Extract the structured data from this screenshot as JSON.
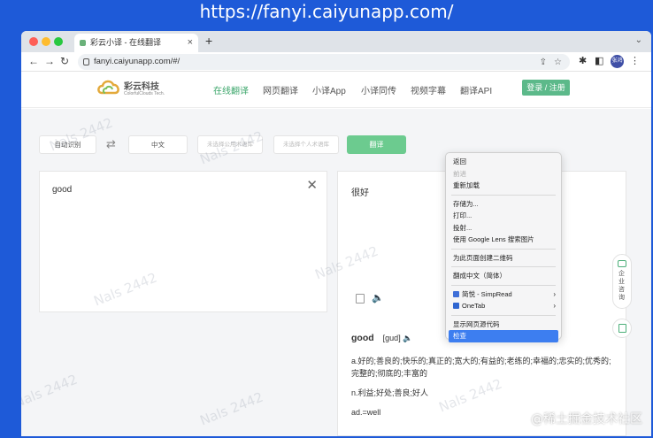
{
  "banner": {
    "url": "https://fanyi.caiyunapp.com/"
  },
  "browser": {
    "tab_title": "彩云小译 - 在线翻译",
    "address": "fanyi.caiyunapp.com/#/",
    "profile_label": "张鸿"
  },
  "site": {
    "logo_text": "彩云科技",
    "logo_sub": "ColorfulClouds Tech.",
    "nav": [
      {
        "label": "在线翻译",
        "active": true
      },
      {
        "label": "网页翻译"
      },
      {
        "label": "小译App"
      },
      {
        "label": "小译同传"
      },
      {
        "label": "视频字幕"
      },
      {
        "label": "翻译API"
      }
    ],
    "login_label": "登录 / 注册"
  },
  "translator": {
    "source_lang": "自动识别",
    "target_lang": "中文",
    "term_placeholder": "未选择公用术语库",
    "personal_placeholder": "未选择个人术语库",
    "translate_label": "翻译",
    "source_text": "good",
    "target_text": "很好"
  },
  "dictionary": {
    "word": "good",
    "phonetic": "[gud]",
    "entries": [
      "a.好的;善良的;快乐的;真正的;宽大的;有益的;老练的;幸福的;忠实的;优秀的;完整的;彻底的;丰富的",
      "n.利益;好处;善良;好人",
      "ad.=well"
    ]
  },
  "side_widget": {
    "label": "企业咨询"
  },
  "context_menu": {
    "groups": [
      [
        {
          "label": "返回"
        },
        {
          "label": "前进",
          "disabled": true
        },
        {
          "label": "重新加载"
        }
      ],
      [
        {
          "label": "存储为..."
        },
        {
          "label": "打印..."
        },
        {
          "label": "投射..."
        },
        {
          "label": "使用 Google Lens 搜索图片"
        }
      ],
      [
        {
          "label": "为此页面创建二维码"
        }
      ],
      [
        {
          "label": "翻成中文（简体）"
        }
      ],
      [
        {
          "label": "简悦 - SimpRead",
          "submenu": true,
          "icon_color": "#3f6fd8"
        },
        {
          "label": "OneTab",
          "submenu": true,
          "icon_color": "#2f66d0"
        }
      ],
      [
        {
          "label": "显示网页源代码"
        },
        {
          "label": "检查",
          "selected": true
        }
      ]
    ]
  },
  "watermarks": {
    "text": "Nals 2442",
    "bottom": "@稀土掘金技术社区"
  },
  "colors": {
    "accent_green": "#5cb98a",
    "banner_blue": "#1e5ad8",
    "menu_highlight": "#3d7ef0"
  }
}
